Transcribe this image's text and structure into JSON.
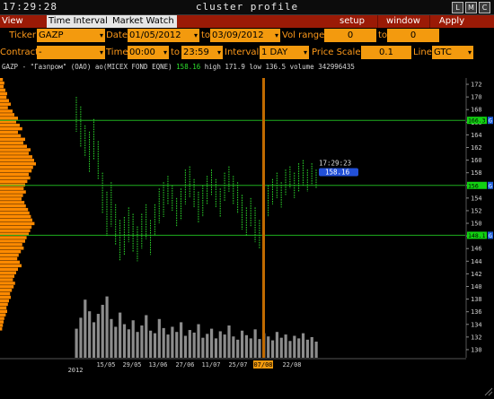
{
  "window": {
    "clock": "17:29:28",
    "title": "cluster profile",
    "controls": [
      "L",
      "M",
      "C"
    ]
  },
  "menubar": {
    "tabs": [
      "View DOM",
      "Time Interval",
      "Market Watch"
    ],
    "active_tab": "Time Interval",
    "buttons": [
      "setup",
      "window",
      "Apply"
    ]
  },
  "filters": {
    "ticker_label": "Ticker",
    "ticker_value": "GAZP",
    "date_label": "Date",
    "date_from": "01/05/2012",
    "date_to_label": "to",
    "date_to": "03/09/2012",
    "vol_range_label": "Vol range",
    "vol_from": "0",
    "vol_to_label": "to",
    "vol_to": "0",
    "contract_label": "Contract",
    "contract_value": "-",
    "time_label": "Time",
    "time_from": "00:00",
    "time_to_label": "to",
    "time_to": "23:59",
    "interval_label": "Interval",
    "interval_value": "1 DAY",
    "price_scale_label": "Price Scale",
    "price_scale_value": "0.1",
    "line_label": "Line",
    "line_value": "GTC"
  },
  "chart_info": {
    "symbol": "GAZP - \"Газпром\" (ОАО) ао(MICEX FOND EQNE)",
    "last": "158.16",
    "high_label": "high",
    "high": "171.9",
    "low_label": "low",
    "low": "136.5",
    "volume_label": "volume",
    "volume": "342996435"
  },
  "colors": {
    "accent": "#f39a0e",
    "menubar": "#9b1a06",
    "candle": "#2de02d",
    "level_line": "#1eae1e",
    "profile": "#ff8a00",
    "volume": "#8c8c8c",
    "cursor": "#c06a00",
    "price_tag": "#2250d8"
  },
  "chart_data": {
    "type": "table",
    "y_ticks": [
      "172",
      "170",
      "168",
      "166",
      "164",
      "162",
      "160",
      "158",
      "156",
      "154",
      "152",
      "150",
      "148",
      "146",
      "144",
      "142",
      "140",
      "138",
      "136",
      "134",
      "132",
      "130"
    ],
    "ylim": [
      129,
      173
    ],
    "x_ticks": [
      "15/05",
      "29/05",
      "13/06",
      "27/06",
      "11/07",
      "25/07",
      "07/08",
      "22/08"
    ],
    "x_year": "2012",
    "cursor_date": "07/08",
    "levels": [
      {
        "price": 166.3,
        "label": "166.3"
      },
      {
        "price": 156.0,
        "label": "156"
      },
      {
        "price": 148.1,
        "label": "148.1"
      }
    ],
    "level_marker": "G",
    "cursor_time": "17:29:23",
    "cursor_price": "158.16",
    "candles": [
      {
        "low": 164.5,
        "high": 170.0
      },
      {
        "low": 162.0,
        "high": 168.5
      },
      {
        "low": 160.5,
        "high": 165.5
      },
      {
        "low": 158.0,
        "high": 164.5
      },
      {
        "low": 160.0,
        "high": 166.5
      },
      {
        "low": 157.0,
        "high": 163.0
      },
      {
        "low": 151.5,
        "high": 158.0
      },
      {
        "low": 148.0,
        "high": 155.0
      },
      {
        "low": 149.5,
        "high": 156.5
      },
      {
        "low": 146.5,
        "high": 153.0
      },
      {
        "low": 144.0,
        "high": 150.5
      },
      {
        "low": 145.0,
        "high": 151.0
      },
      {
        "low": 147.0,
        "high": 152.5
      },
      {
        "low": 145.5,
        "high": 151.5
      },
      {
        "low": 144.0,
        "high": 149.5
      },
      {
        "low": 146.0,
        "high": 151.5
      },
      {
        "low": 147.5,
        "high": 153.0
      },
      {
        "low": 145.0,
        "high": 150.5
      },
      {
        "low": 148.0,
        "high": 153.0
      },
      {
        "low": 150.0,
        "high": 155.5
      },
      {
        "low": 151.0,
        "high": 156.5
      },
      {
        "low": 153.0,
        "high": 157.5
      },
      {
        "low": 152.0,
        "high": 156.0
      },
      {
        "low": 149.5,
        "high": 154.0
      },
      {
        "low": 150.5,
        "high": 155.5
      },
      {
        "low": 153.0,
        "high": 158.5
      },
      {
        "low": 154.0,
        "high": 159.0
      },
      {
        "low": 152.5,
        "high": 157.0
      },
      {
        "low": 150.0,
        "high": 155.0
      },
      {
        "low": 151.0,
        "high": 156.0
      },
      {
        "low": 153.0,
        "high": 157.5
      },
      {
        "low": 154.5,
        "high": 158.5
      },
      {
        "low": 152.5,
        "high": 157.0
      },
      {
        "low": 151.0,
        "high": 155.5
      },
      {
        "low": 153.5,
        "high": 158.0
      },
      {
        "low": 155.0,
        "high": 159.0
      },
      {
        "low": 153.0,
        "high": 157.5
      },
      {
        "low": 151.5,
        "high": 156.5
      },
      {
        "low": 149.0,
        "high": 154.5
      },
      {
        "low": 148.0,
        "high": 152.5
      },
      {
        "low": 149.5,
        "high": 154.0
      },
      {
        "low": 147.0,
        "high": 152.5
      },
      {
        "low": 146.0,
        "high": 150.5
      },
      {
        "low": 148.5,
        "high": 153.5
      },
      {
        "low": 151.0,
        "high": 156.0
      },
      {
        "low": 153.0,
        "high": 157.0
      },
      {
        "low": 154.0,
        "high": 158.0
      },
      {
        "low": 152.5,
        "high": 156.5
      },
      {
        "low": 154.5,
        "high": 158.5
      },
      {
        "low": 155.5,
        "high": 159.0
      },
      {
        "low": 154.0,
        "high": 158.0
      },
      {
        "low": 155.0,
        "high": 159.5
      },
      {
        "low": 156.0,
        "high": 160.0
      },
      {
        "low": 155.0,
        "high": 158.5
      },
      {
        "low": 156.0,
        "high": 159.5
      },
      {
        "low": 155.5,
        "high": 158.5
      }
    ],
    "volumes": [
      0.45,
      0.62,
      0.9,
      0.72,
      0.55,
      0.68,
      0.82,
      0.95,
      0.6,
      0.48,
      0.7,
      0.52,
      0.44,
      0.58,
      0.4,
      0.5,
      0.66,
      0.42,
      0.38,
      0.6,
      0.46,
      0.36,
      0.48,
      0.4,
      0.55,
      0.34,
      0.43,
      0.39,
      0.52,
      0.31,
      0.37,
      0.45,
      0.3,
      0.41,
      0.36,
      0.5,
      0.33,
      0.28,
      0.42,
      0.35,
      0.3,
      0.44,
      0.29,
      0.38,
      0.33,
      0.27,
      0.4,
      0.31,
      0.36,
      0.26,
      0.34,
      0.3,
      0.38,
      0.28,
      0.32,
      0.25
    ],
    "profile": [
      0.08,
      0.12,
      0.1,
      0.15,
      0.2,
      0.18,
      0.25,
      0.3,
      0.22,
      0.35,
      0.4,
      0.5,
      0.45,
      0.55,
      0.62,
      0.5,
      0.58,
      0.7,
      0.65,
      0.75,
      0.85,
      0.8,
      0.9,
      0.95,
      1.0,
      0.92,
      0.88,
      0.8,
      0.84,
      0.76,
      0.7,
      0.66,
      0.72,
      0.64,
      0.6,
      0.68,
      0.72,
      0.78,
      0.82,
      0.86,
      0.9,
      0.96,
      0.88,
      0.84,
      0.8,
      0.74,
      0.7,
      0.62,
      0.66,
      0.58,
      0.52,
      0.48,
      0.55,
      0.6,
      0.5,
      0.45,
      0.4,
      0.36,
      0.42,
      0.38,
      0.33,
      0.28,
      0.3,
      0.25,
      0.22,
      0.18,
      0.2,
      0.16,
      0.12,
      0.1,
      0.08,
      0.06
    ]
  }
}
